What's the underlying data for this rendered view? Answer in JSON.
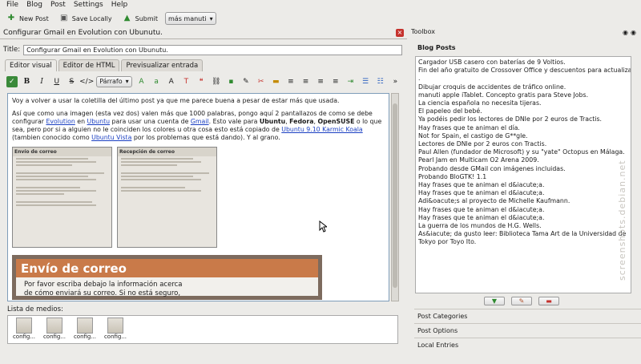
{
  "menu": [
    "File",
    "Blog",
    "Post",
    "Settings",
    "Help"
  ],
  "toolbar": {
    "new_post": "New Post",
    "save_locally": "Save Locally",
    "submit": "Submit",
    "more_select": "más manuti"
  },
  "document": {
    "tab_title": "Configurar Gmail en Evolution con Ubunutu.",
    "title_label": "Title:",
    "title_value": "Configurar Gmail en Evolution con Ubunutu."
  },
  "editor_tabs": [
    "Editor visual",
    "Editor de HTML",
    "Previsualizar entrada"
  ],
  "format": {
    "paragraph_select": "Párrafo"
  },
  "content": {
    "p1": "Voy a volver a usar la coletilla del último post ya que me parece buena a pesar de estar más que usada.",
    "p2a": "Así que como una imagen (esta vez dos) valen más que 1000 palabras, pongo aquí 2 pantallazos de como se debe configurar ",
    "link_evolution": "Evolution",
    "p2b": " en ",
    "link_ubuntu": "Ubuntu",
    "p2c": " para usar una cuenta de ",
    "link_gmail": "Gmail",
    "p2d": ". Esto vale para ",
    "b_ubuntu": "Ubuntu",
    "p2e": ", ",
    "b_fedora": "Fedora",
    "p2f": ", ",
    "b_opensuse": "OpenSUSE",
    "p2g": " o lo que sea, pero por si a alguien no le coinciden los colores u otra cosa esto está copiado de ",
    "link_karmic": "Ubuntu 9.10 Karmic Koala",
    "p2h": " (tambien conocido como ",
    "link_vista": "Ubuntu Vista",
    "p2i": " por los problemas que está dando). Y al grano.",
    "shot1_title": "Envío de correo",
    "shot2_title": "Recepción de correo",
    "big_title": "Envío de correo",
    "big_text_1": "Por favor escriba debajo la información acerca",
    "big_text_2": "de cómo enviará su correo. Si no está seguro,"
  },
  "media": {
    "label": "Lista de medios:",
    "items": [
      "config...",
      "config...",
      "config...",
      "config..."
    ]
  },
  "toolbox": {
    "title": "Toolbox",
    "blog_posts_label": "Blog Posts",
    "posts": [
      "Cargador USB casero con baterías de 9 Voltios.",
      "Fin del año gratuito de Crossover Office y descuentos para actualizarlo",
      ".",
      "Dibujar croquis de accidentes de tráfico online.",
      "manuti apple iTablet. Concepto gratis para Steve Jobs.",
      "La ciencia española no necesita tijeras.",
      "El papeleo del bebé.",
      "Ya podéis pedir los lectores de DNIe por 2 euros de Tractis.",
      "Hay frases que te animan el día.",
      "Not for Spain, el castigo de G**gle.",
      "Lectores de DNIe por 2 euros con Tractis.",
      "Paul Allen (fundador de Microsoft) y su \"yate\" Octopus en Málaga.",
      "Pearl Jam en Multicam O2 Arena 2009.",
      "Probando desde GMail con imágenes incluidas.",
      "Probando BloGTK! 1.1",
      "Hay frases que te animan el d&iacute;a.",
      "Hay frases que te animan el d&iacute;a.",
      "Adi&oacute;s al proyecto de Michelle Kaufmann.",
      "Hay frases que te animan el d&iacute;a.",
      "Hay frases que te animan el d&iacute;a.",
      "La guerra de los mundos de H.G. Wells.",
      "As&iacute; da gusto leer: Biblioteca Tama Art de la Universidad de",
      "Tokyo por Toyo Ito."
    ],
    "sections": [
      "Post Categories",
      "Post Options",
      "Local Entries"
    ]
  },
  "watermark": "screenshots.debian.net",
  "colors": {
    "accent_orange": "#c97a49",
    "link": "#1a3fc2",
    "close_red": "#c5322d"
  }
}
